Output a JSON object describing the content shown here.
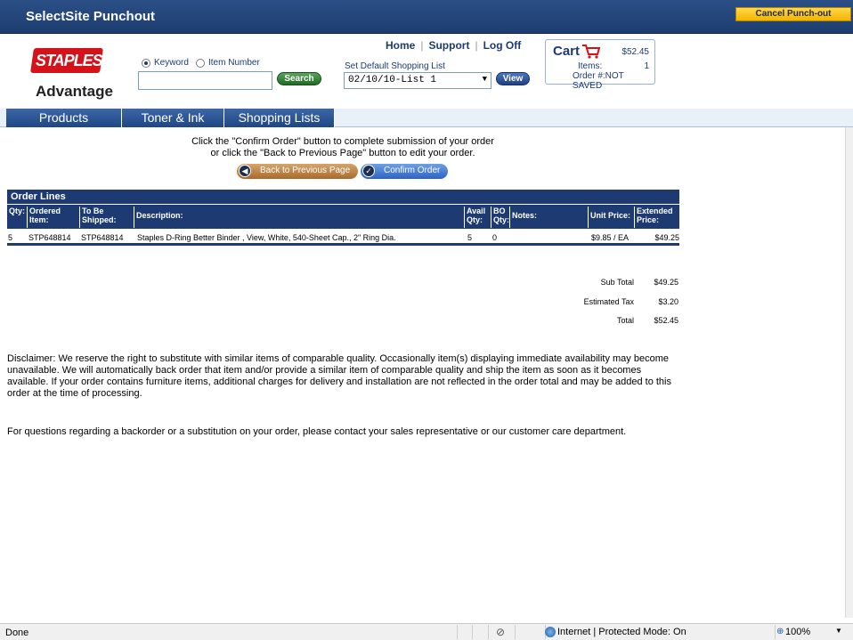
{
  "titlebar": {
    "title": "SelectSite Punchout",
    "cancel_label": "Cancel Punch-out"
  },
  "header": {
    "logo_text": "STAPLES",
    "logo_sub": "Advantage",
    "search": {
      "keyword_label": "Keyword",
      "item_label": "Item Number",
      "value": "",
      "button": "Search"
    },
    "nav": {
      "home": "Home",
      "support": "Support",
      "logoff": "Log Off"
    },
    "shopping_list": {
      "label": "Set Default Shopping List",
      "selected": "02/10/10-List 1",
      "view_button": "View"
    },
    "cart": {
      "label": "Cart",
      "total": "$52.45",
      "items_label": "Items:",
      "items_count": "1",
      "order": "Order #:NOT SAVED"
    }
  },
  "tabs": [
    "Products",
    "Toner & Ink",
    "Shopping Lists"
  ],
  "instructions": {
    "line1": "Click the \"Confirm Order\" button to complete submission of your order",
    "line2": "or click the \"Back to Previous Page\" button to edit your order."
  },
  "buttons": {
    "back": "Back to Previous Page",
    "confirm": "Confirm Order"
  },
  "order": {
    "title": "Order Lines",
    "columns": {
      "qty": "Qty:",
      "ordered_item": "Ordered Item:",
      "to_be_shipped": "To Be Shipped:",
      "description": "Description:",
      "avail_qty": "Avail Qty:",
      "bo_qty": "BO Qty:",
      "notes": "Notes:",
      "unit_price": "Unit Price:",
      "extended_price": "Extended Price:"
    },
    "rows": [
      {
        "qty": "5",
        "ordered_item": "STP648814",
        "to_be_shipped": "STP648814",
        "description": "Staples D-Ring Better Binder , View, White, 540-Sheet Cap., 2\" Ring Dia.",
        "avail_qty": "5",
        "bo_qty": "0",
        "notes": "",
        "unit_price": "$9.85 / EA",
        "extended_price": "$49.25"
      }
    ]
  },
  "totals": {
    "subtotal_label": "Sub Total",
    "subtotal": "$49.25",
    "tax_label": "Estimated Tax",
    "tax": "$3.20",
    "total_label": "Total",
    "total": "$52.45"
  },
  "disclaimer": "Disclaimer: We reserve the right to substitute with similar items of comparable quality. Occasionally item(s) displaying immediate availability may become unavailable. We will automatically back order that item and/or provide a similar item of comparable quality and ship the item as soon as it becomes available. If your order contains furniture items, additional charges for delivery and installation are not reflected in the order total and may be added to this order at the time of processing.",
  "questions": "For questions regarding a backorder or a substitution on your order, please contact your sales representative or our customer care department.",
  "statusbar": {
    "status": "Done",
    "zone": "Internet | Protected Mode: On",
    "zoom": "100%"
  },
  "colors": {
    "navy": "#1d3a73",
    "brand_red": "#d5121a",
    "cancel_yellow": "#f2b400",
    "search_green": "#1f6b20"
  }
}
